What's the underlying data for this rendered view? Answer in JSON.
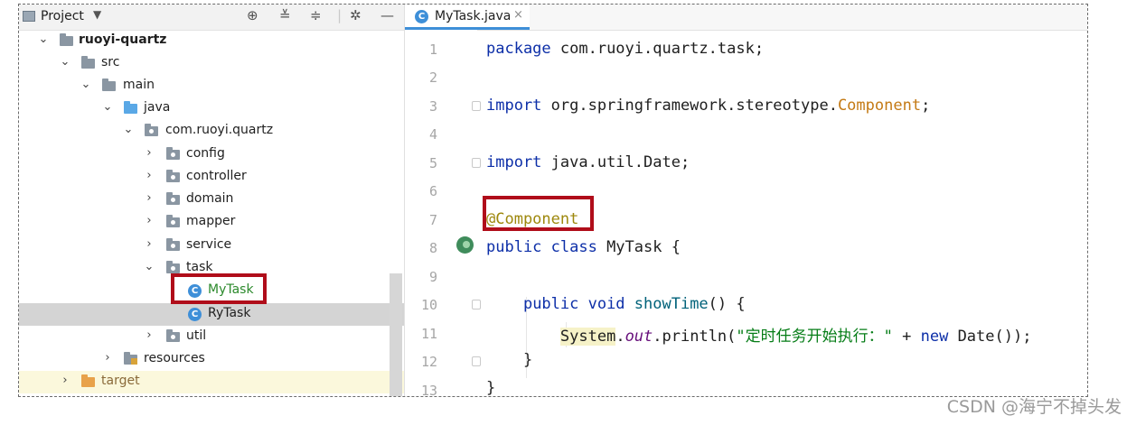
{
  "project_panel": {
    "title": "Project",
    "tree": [
      {
        "label": "ruoyi-quartz",
        "chevron": "⌄"
      },
      {
        "label": "src",
        "chevron": "⌄"
      },
      {
        "label": "main",
        "chevron": "⌄"
      },
      {
        "label": "java",
        "chevron": "⌄"
      },
      {
        "label": "com.ruoyi.quartz",
        "chevron": "⌄"
      },
      {
        "label": "config",
        "chevron": "›"
      },
      {
        "label": "controller",
        "chevron": "›"
      },
      {
        "label": "domain",
        "chevron": "›"
      },
      {
        "label": "mapper",
        "chevron": "›"
      },
      {
        "label": "service",
        "chevron": "›"
      },
      {
        "label": "task",
        "chevron": "⌄"
      },
      {
        "label": "MyTask"
      },
      {
        "label": "RyTask"
      },
      {
        "label": "util",
        "chevron": "›"
      },
      {
        "label": "resources",
        "chevron": "›"
      },
      {
        "label": "target",
        "chevron": "›"
      }
    ]
  },
  "editor": {
    "tab": {
      "label": "MyTask.java",
      "close": "×",
      "class_icon": "C"
    },
    "line_numbers": [
      "1",
      "2",
      "3",
      "4",
      "5",
      "6",
      "7",
      "8",
      "9",
      "10",
      "11",
      "12",
      "13"
    ],
    "code": {
      "l1": {
        "kw": "package",
        "rest": " com.ruoyi.quartz.task;"
      },
      "l3": {
        "kw": "import",
        "path": " org.springframework.stereotype.",
        "type": "Component",
        "end": ";"
      },
      "l5": {
        "kw": "import",
        "rest": " java.util.Date;"
      },
      "l7": {
        "annotation": "@Component"
      },
      "l8": {
        "kw": "public class",
        "rest": " MyTask {"
      },
      "l10": {
        "indent": "    ",
        "kw": "public void",
        "method": " showTime",
        "rest": "() {"
      },
      "l11": {
        "indent": "        ",
        "sys": "System",
        "dot": ".",
        "field": "out",
        "call": ".println(",
        "str": "\"定时任务开始执行：\"",
        "plus": " + ",
        "kw_new": "new",
        "end": " Date());"
      },
      "l12": {
        "indent": "    ",
        "rest": "}"
      },
      "l13": {
        "rest": "}"
      }
    }
  },
  "colors": {
    "highlight_box": "#b00d1a",
    "keyword": "#0d2fa8",
    "annotation": "#9e880d"
  },
  "watermark": "CSDN @海宁不掉头发"
}
